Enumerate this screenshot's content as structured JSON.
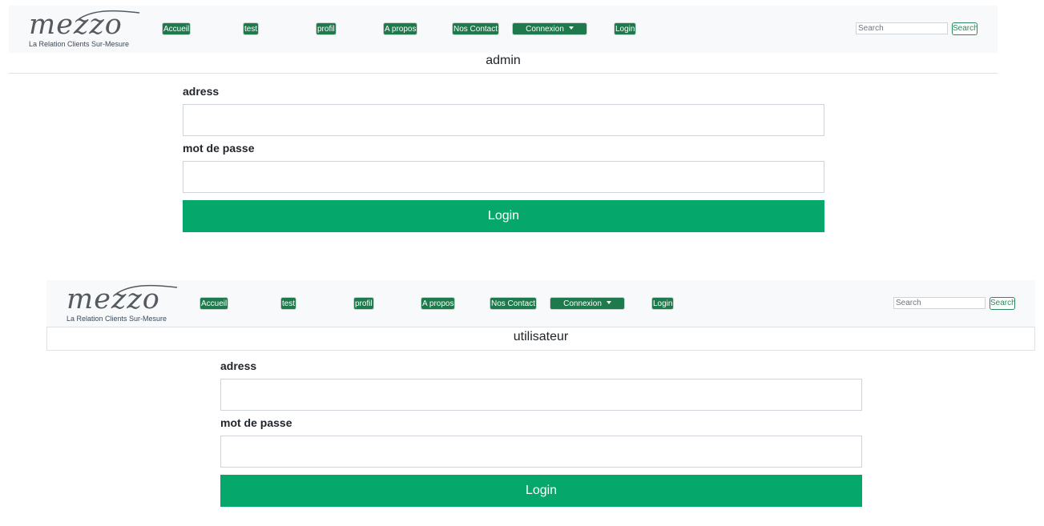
{
  "navbar": {
    "logo": {
      "word": "mezzo",
      "tagline": "La Relation Clients Sur-Mesure"
    },
    "items": [
      "Accueil",
      "test",
      "profil",
      "A propos",
      "Nos Contact"
    ],
    "dropdown_label": "Connexion",
    "login_link": "Login",
    "search_placeholder": "Search",
    "search_button": "Search"
  },
  "panels": [
    {
      "role_title": "admin",
      "address_label": "adress",
      "password_label": "mot de passe",
      "login_button": "Login"
    },
    {
      "role_title": "utilisateur",
      "address_label": "adress",
      "password_label": "mot de passe",
      "login_button": "Login"
    }
  ],
  "colors": {
    "nav_button": "#1e7a4c",
    "login_button": "#05a86a",
    "navbar_bg": "#f8f9fa"
  }
}
